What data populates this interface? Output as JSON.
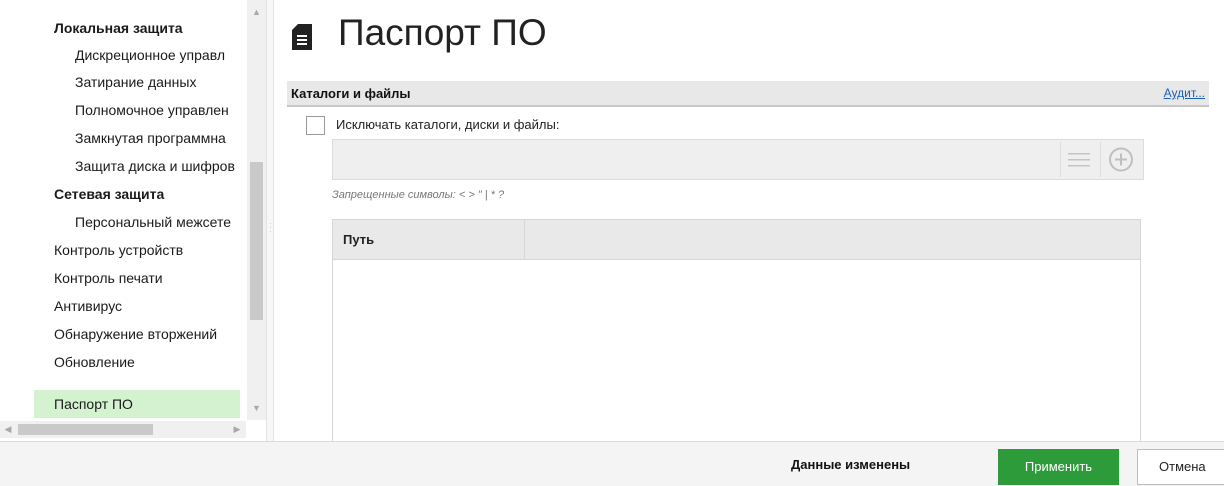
{
  "nav": {
    "items": [
      {
        "label": "Локальная защита",
        "level": 0,
        "bold": true
      },
      {
        "label": "Дискреционное управл",
        "level": 1,
        "bold": false
      },
      {
        "label": "Затирание данных",
        "level": 1,
        "bold": false
      },
      {
        "label": "Полномочное управлен",
        "level": 1,
        "bold": false
      },
      {
        "label": "Замкнутая программна",
        "level": 1,
        "bold": false
      },
      {
        "label": "Защита диска и шифров",
        "level": 1,
        "bold": false
      },
      {
        "label": "Сетевая защита",
        "level": 0,
        "bold": true
      },
      {
        "label": "Персональный межсете",
        "level": 1,
        "bold": false
      },
      {
        "label": "Контроль устройств",
        "level": 0,
        "bold": false
      },
      {
        "label": "Контроль печати",
        "level": 0,
        "bold": false
      },
      {
        "label": "Антивирус",
        "level": 0,
        "bold": false
      },
      {
        "label": "Обнаружение вторжений",
        "level": 0,
        "bold": false
      },
      {
        "label": "Обновление",
        "level": 0,
        "bold": false
      },
      {
        "label": "Паспорт ПО",
        "level": 0,
        "bold": false,
        "selected": true
      }
    ],
    "selected_color": "#d4f2cf"
  },
  "page": {
    "title": "Паспорт ПО",
    "title_icon": "document-icon"
  },
  "section": {
    "title": "Каталоги и файлы",
    "audit_link": "Аудит..."
  },
  "exclude": {
    "checkbox_label": "Исключать каталоги, диски и файлы:",
    "checked": false,
    "input_value": "",
    "input_placeholder": "",
    "list_icon": "list-icon",
    "add_icon": "add-circle-icon",
    "forbidden_note": "Запрещенные символы: < > \" | * ?"
  },
  "table": {
    "columns": [
      "Путь",
      ""
    ],
    "rows": []
  },
  "footer": {
    "status": "Данные изменены",
    "apply_label": "Применить",
    "cancel_label": "Отмена",
    "apply_color": "#2e9b3a"
  }
}
